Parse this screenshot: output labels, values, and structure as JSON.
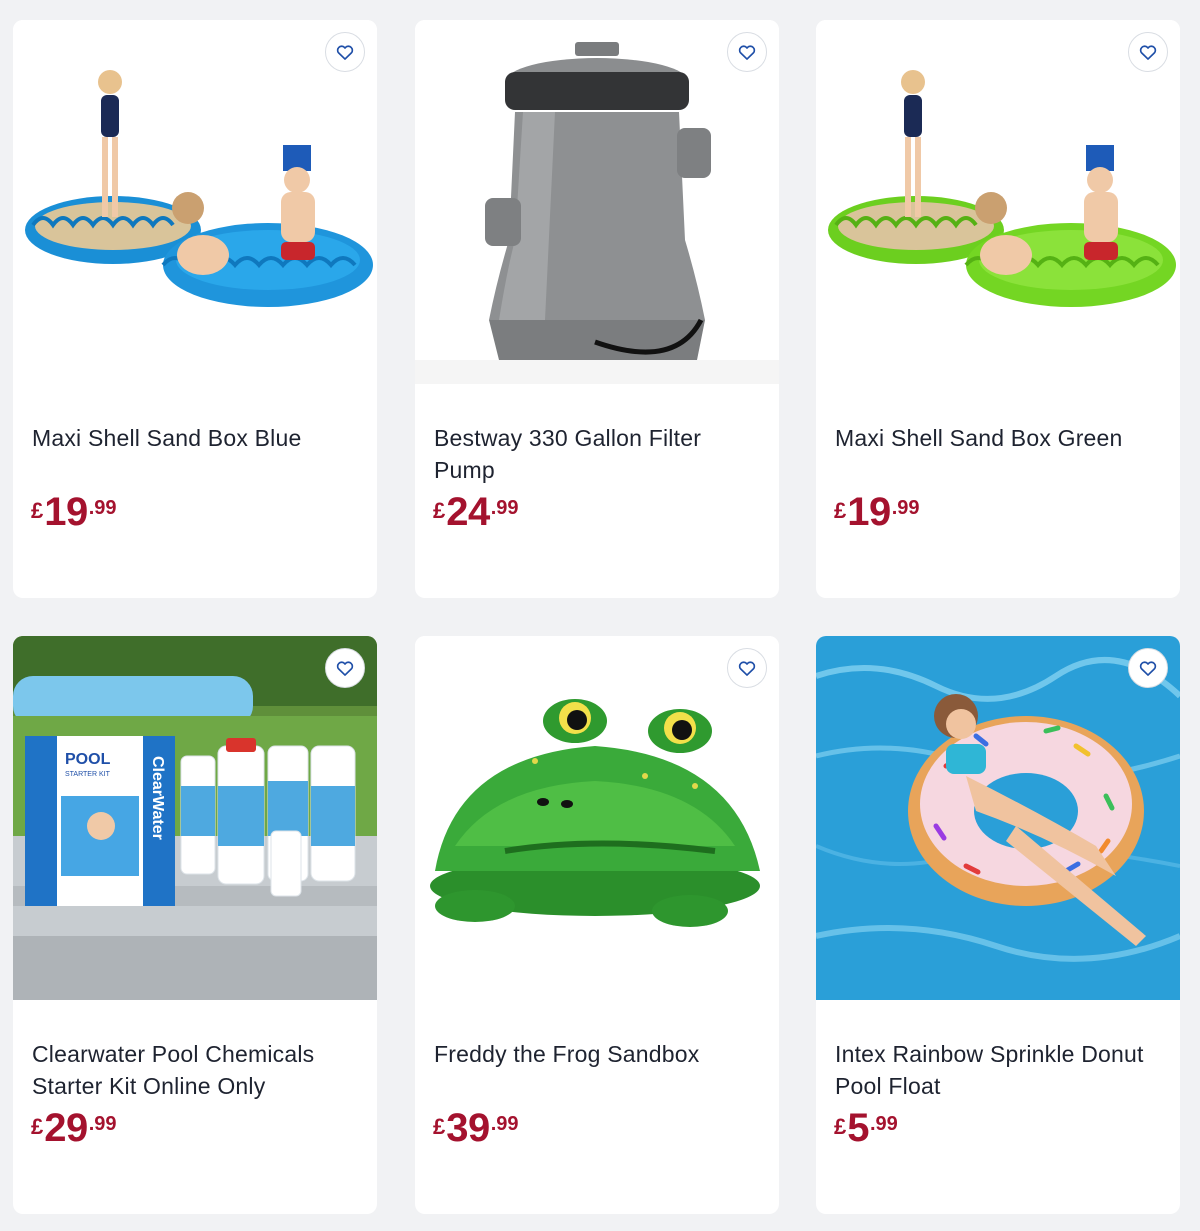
{
  "products": [
    {
      "title": "Maxi Shell Sand Box Blue",
      "currency": "£",
      "price_main": "19",
      "price_dec": ".99",
      "image_alt": "blue shell sand box"
    },
    {
      "title": "Bestway 330 Gallon Filter Pump",
      "currency": "£",
      "price_main": "24",
      "price_dec": ".99",
      "image_alt": "filter pump"
    },
    {
      "title": "Maxi Shell Sand Box Green",
      "currency": "£",
      "price_main": "19",
      "price_dec": ".99",
      "image_alt": "green shell sand box"
    },
    {
      "title": "Clearwater Pool Chemicals Starter Kit Online Only",
      "currency": "£",
      "price_main": "29",
      "price_dec": ".99",
      "image_alt": "pool chemicals kit"
    },
    {
      "title": "Freddy the Frog Sandbox",
      "currency": "£",
      "price_main": "39",
      "price_dec": ".99",
      "image_alt": "frog sandbox"
    },
    {
      "title": "Intex Rainbow Sprinkle Donut Pool Float",
      "currency": "£",
      "price_main": "5",
      "price_dec": ".99",
      "image_alt": "donut pool float"
    }
  ],
  "image_text": {
    "kit_box_title": "POOL",
    "kit_box_subtitle": "STARTER KIT",
    "kit_brand": "ClearWater"
  },
  "icons": {
    "wishlist": "heart-outline-icon"
  },
  "colors": {
    "price": "#a4122e",
    "wishlist_icon": "#1f4fa8",
    "background": "#f1f2f4"
  }
}
